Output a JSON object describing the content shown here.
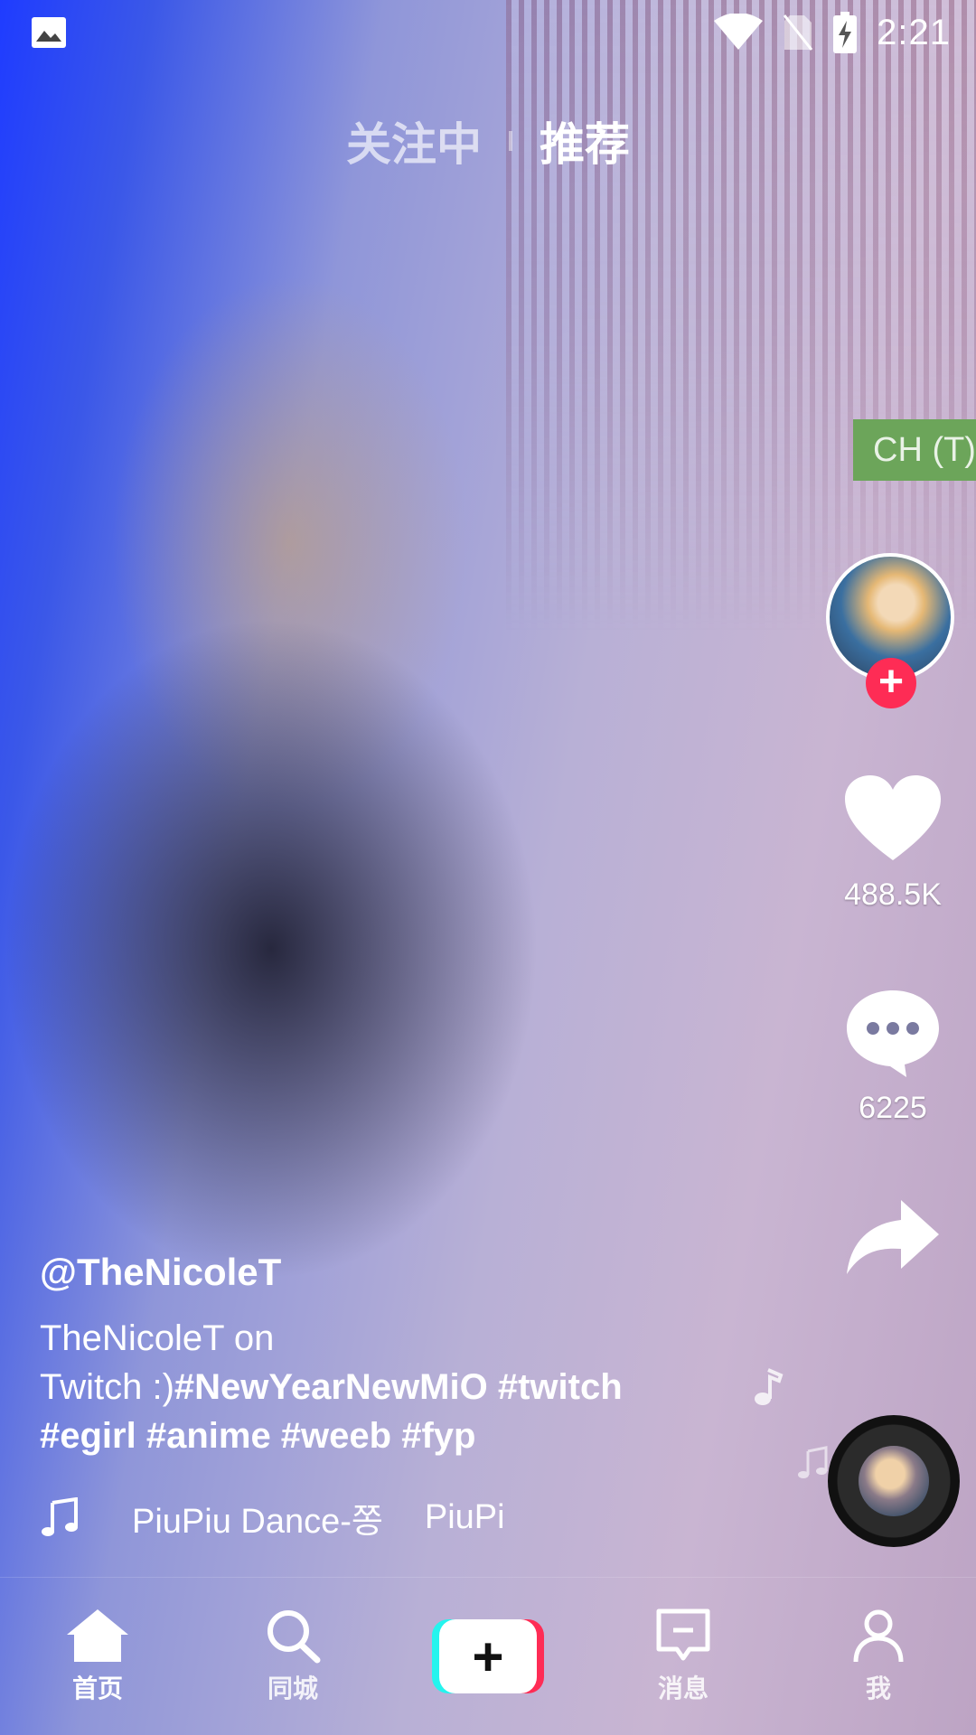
{
  "status_bar": {
    "time": "2:21",
    "icons": [
      "image-icon",
      "wifi-icon",
      "no-sim-icon",
      "battery-charging-icon"
    ]
  },
  "top_tabs": [
    {
      "label": "关注中",
      "active": false
    },
    {
      "label": "推荐",
      "active": true
    }
  ],
  "translate_badge": "CH (T)",
  "creator": {
    "avatar_icon": "creator-avatar",
    "follow_icon": "plus-icon"
  },
  "actions": {
    "likes": "488.5K",
    "comments": "6225",
    "share_icon": "share-arrow-icon"
  },
  "post": {
    "username": "@TheNicoleT",
    "caption_line1": "TheNicoleT on",
    "caption_line2_prefix": "Twitch :)",
    "caption_line2_tags": "#NewYearNewMiO #twitch",
    "caption_line3_tags": "#egirl #anime #weeb #fyp",
    "music_title": "PiuPiu Dance-쫑",
    "music_artist": "PiuPi"
  },
  "bottom_nav": [
    {
      "label": "首页",
      "icon": "home-icon",
      "active": true
    },
    {
      "label": "同城",
      "icon": "search-icon",
      "active": false
    },
    {
      "label": "",
      "icon": "create-plus-icon",
      "active": false
    },
    {
      "label": "消息",
      "icon": "inbox-icon",
      "active": false
    },
    {
      "label": "我",
      "icon": "profile-icon",
      "active": false
    }
  ],
  "colors": {
    "accent_red": "#fe2c55",
    "accent_cyan": "#25f4ee",
    "translate_green": "#6ca55a"
  }
}
